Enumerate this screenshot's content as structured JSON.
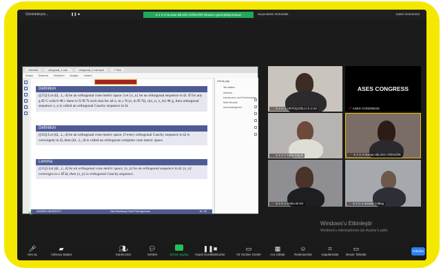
{
  "app": {
    "meeting_title": "Görüntüleyici...",
    "banner": "S 2 H 2 Nursan BİLGİO GÖNGÖR ekranını görüntülüyorsunuz",
    "view_options": "Seçenekleri Görüntüle",
    "top_right": "Galeri Görünümü"
  },
  "pdf": {
    "tabs": [
      "Görüntü",
      "ortogonal_1.cat...",
      "ortogonal_2.cat.mpd",
      "+ Yeni"
    ],
    "menu": [
      "Dosya",
      "Düzenle",
      "Görünüm",
      "Araçlar",
      "Yardım"
    ],
    "search_label": "Görüş yap",
    "side_heading": "Yer İmleri",
    "side_items": [
      "Abstract",
      "Introduction and Preliminaries",
      "Main Results",
      "Acknowledgment"
    ],
    "blocks": [
      {
        "title": "Definition",
        "body": "([15]) Let (Ω, ⊥, d) be an orthogonal cone metric space. Let {x_n} be an orthogonal sequence in Ω. If for any g ∈ G with θ ≪ c there is N ∈ ℕ such that for all n, m ≥ N (n, m ∈ ℕ), σ(x_n, x_m) ≪ g, then orthogonal sequence x_n is called an orthogonal Cauchy sequence in Ω.",
        "italic": false
      },
      {
        "title": "Definition",
        "body": "([16]) Let (Ω, ⊥, d) be an orthogonal cone metric space, if every orthogonal Cauchy sequence in Ω is convergent in Ω, then (Ω, ⊥, d) is called an orthogonal complete cone metric space.",
        "italic": false
      },
      {
        "title": "Lemma",
        "body": "([15]) Let (Ω, ⊥, d) be an orthogonal cone metric space, {x_n} be an orthogonal sequence in Ω. {x_n} converges to x ∈ Ω, then {x_n} is orthogonal Cauchy sequence.",
        "italic": true
      }
    ],
    "footer_left": "ANKARA UNIVERSITY",
    "footer_mid": "New Workshop Fixed Point Approach",
    "footer_right": "16 / 30"
  },
  "participants": [
    {
      "name": "S 2 H 2 ORTÜÇOĞLU S 2 H2",
      "muted": true,
      "kind": "video"
    },
    {
      "name": "ASES CONGRESS",
      "muted": true,
      "kind": "logo",
      "logo_text": "ASES CONGRESS"
    },
    {
      "name": "S 2 H 2 Tuba Küçük",
      "muted": true,
      "kind": "video"
    },
    {
      "name": "S 2 H 2 Nursan BİLGİO GÖNGÖR",
      "muted": true,
      "kind": "video",
      "active": true
    },
    {
      "name": "S 2 H 2 Sebla Bİ EK",
      "muted": true,
      "kind": "video"
    },
    {
      "name": "S 2 H 2 Savdar Tülbaş",
      "muted": true,
      "kind": "video"
    }
  ],
  "watermark": {
    "line1": "Windows'u Etkinleştir",
    "line2": "Windows'u etkinleştirmek için Ayarlar'a gidin."
  },
  "toolbar": {
    "items": [
      {
        "label": "Ses aç",
        "icon": "microphone-muted-icon"
      },
      {
        "label": "Videoyu Başlat",
        "icon": "video-off-icon"
      },
      {
        "label": "Katılımcılar",
        "icon": "participants-icon",
        "badge": "6"
      },
      {
        "label": "Sohbet",
        "icon": "chat-icon"
      },
      {
        "label": "Ekranı paylaş",
        "icon": "share-screen-icon",
        "accent": true
      },
      {
        "label": "Kaydı Durakla/Durdur",
        "icon": "pause-stop-icon"
      },
      {
        "label": "Alt Yazıları Göster",
        "icon": "captions-icon"
      },
      {
        "label": "Ara Odalar",
        "icon": "breakout-rooms-icon"
      },
      {
        "label": "Reaksiyonlar",
        "icon": "reactions-icon"
      },
      {
        "label": "Uygulamalar",
        "icon": "apps-icon"
      },
      {
        "label": "Beyaz Tahtalar",
        "icon": "whiteboard-icon"
      }
    ],
    "end_label": "Odadan"
  },
  "colors": {
    "frame": "#f5e800",
    "beamer_blue": "#4e5c95",
    "accent_green": "#23c15b",
    "muted_red": "#ff3b30",
    "end_blue": "#2d7ff9"
  }
}
